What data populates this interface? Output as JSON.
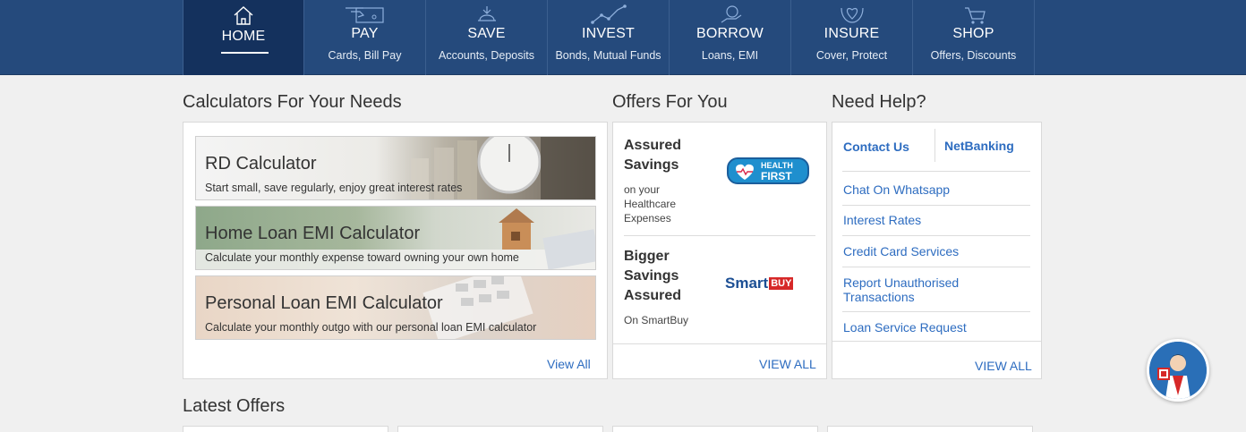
{
  "nav": {
    "items": [
      {
        "title": "HOME",
        "sub": "",
        "icon": "home-icon"
      },
      {
        "title": "PAY",
        "sub": "Cards, Bill Pay",
        "icon": "card-pay-icon"
      },
      {
        "title": "SAVE",
        "sub": "Accounts, Deposits",
        "icon": "piggy-save-icon"
      },
      {
        "title": "INVEST",
        "sub": "Bonds, Mutual Funds",
        "icon": "growth-chart-icon"
      },
      {
        "title": "BORROW",
        "sub": "Loans, EMI",
        "icon": "rupee-hand-icon"
      },
      {
        "title": "INSURE",
        "sub": "Cover, Protect",
        "icon": "protect-hands-icon"
      },
      {
        "title": "SHOP",
        "sub": "Offers, Discounts",
        "icon": "cart-icon"
      }
    ]
  },
  "calculators": {
    "heading": "Calculators For Your Needs",
    "items": [
      {
        "title": "RD Calculator",
        "desc": "Start small, save regularly, enjoy great interest rates"
      },
      {
        "title": "Home Loan EMI Calculator",
        "desc": "Calculate your monthly expense toward owning your own home"
      },
      {
        "title": "Personal Loan EMI Calculator",
        "desc": "Calculate your monthly outgo with our personal loan EMI calculator"
      }
    ],
    "view_all": "View All"
  },
  "offers": {
    "heading": "Offers For You",
    "items": [
      {
        "title_line1": "Assured",
        "title_line2": "Savings",
        "title_line3": "",
        "desc_line1": "on your",
        "desc_line2": "Healthcare",
        "desc_line3": "Expenses",
        "logo_line1": "HEALTH",
        "logo_line2": "FIRST"
      },
      {
        "title_line1": "Bigger",
        "title_line2": "Savings",
        "title_line3": "Assured",
        "desc_line1": "On SmartBuy",
        "logo_a": "Smart",
        "logo_b": "BUY"
      }
    ],
    "view_all": "VIEW ALL"
  },
  "help": {
    "heading": "Need Help?",
    "contact": "Contact Us",
    "netbanking": "NetBanking",
    "links": [
      "Chat On Whatsapp",
      "Interest Rates",
      "Credit Card Services",
      "Report Unauthorised Transactions",
      "Loan Service Request"
    ],
    "view_all": "VIEW ALL"
  },
  "latest": {
    "heading": "Latest Offers"
  },
  "colors": {
    "nav_bg": "#254a7c",
    "nav_active": "#14315d",
    "link": "#2d6cc0"
  }
}
